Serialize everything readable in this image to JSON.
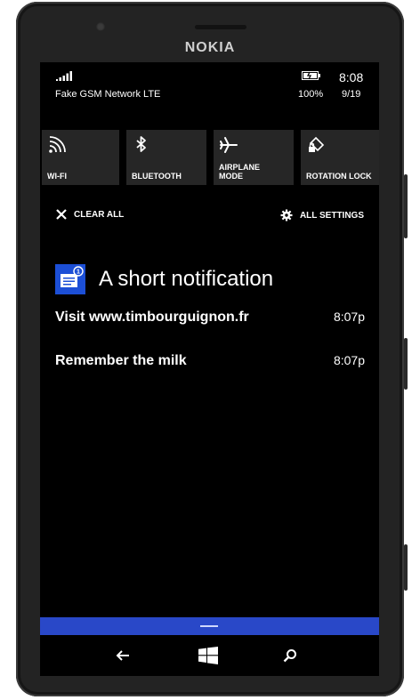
{
  "device": {
    "brand": "NOKIA"
  },
  "status_bar": {
    "network": "Fake GSM Network LTE",
    "time": "8:08",
    "battery_percent": "100%",
    "date": "9/19"
  },
  "quick_actions": [
    {
      "label": "WI-FI",
      "icon": "wifi-icon"
    },
    {
      "label": "BLUETOOTH",
      "icon": "bluetooth-icon"
    },
    {
      "label": "AIRPLANE MODE",
      "icon": "airplane-icon"
    },
    {
      "label": "ROTATION LOCK",
      "icon": "rotation-lock-icon"
    }
  ],
  "actions": {
    "clear_all": "CLEAR ALL",
    "all_settings": "ALL SETTINGS"
  },
  "notification_group": {
    "app_title": "A short notification",
    "badge": "1",
    "items": [
      {
        "text": "Visit www.timbourguignon.fr",
        "time": "8:07p"
      },
      {
        "text": "Remember the milk",
        "time": "8:07p"
      }
    ]
  },
  "colors": {
    "accent": "#2948c8",
    "app_tile": "#1c4fd6",
    "tile_bg": "#262626"
  }
}
